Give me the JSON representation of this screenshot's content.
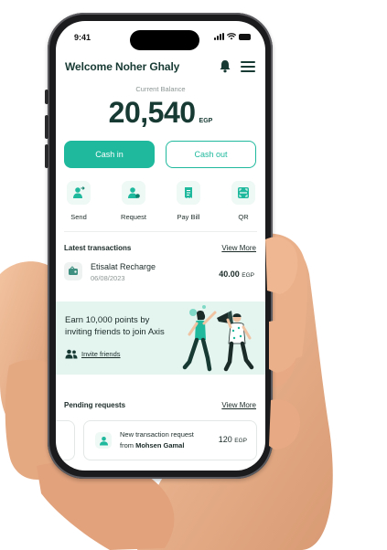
{
  "status_bar": {
    "time": "9:41"
  },
  "header": {
    "greeting": "Welcome Noher Ghaly"
  },
  "balance": {
    "label": "Current Balance",
    "amount": "20,540",
    "currency": "EGP"
  },
  "actions": {
    "cash_in": "Cash in",
    "cash_out": "Cash out"
  },
  "quick_actions": [
    {
      "label": "Send",
      "icon": "send-user-icon"
    },
    {
      "label": "Request",
      "icon": "request-user-icon"
    },
    {
      "label": "Pay Bill",
      "icon": "bill-icon"
    },
    {
      "label": "QR",
      "icon": "qr-scan-icon"
    }
  ],
  "latest_transactions": {
    "title": "Latest transactions",
    "view_more": "View More",
    "items": [
      {
        "name": "Etisalat Recharge",
        "date": "06/08/2023",
        "amount": "40.00",
        "currency": "EGP"
      }
    ]
  },
  "banner": {
    "text": "Earn 10,000 points by inviting  friends to join Axis",
    "link": "Invite friends"
  },
  "pending_requests": {
    "title": "Pending requests",
    "view_more": "View More",
    "items": [
      {
        "line1": "New transaction request",
        "prefix": "from",
        "from": "Mohsen Gamal",
        "amount": "120",
        "currency": "EGP"
      }
    ]
  },
  "colors": {
    "accent": "#1fb99d",
    "dark_text": "#173a33",
    "banner_bg": "#e4f5f0"
  }
}
